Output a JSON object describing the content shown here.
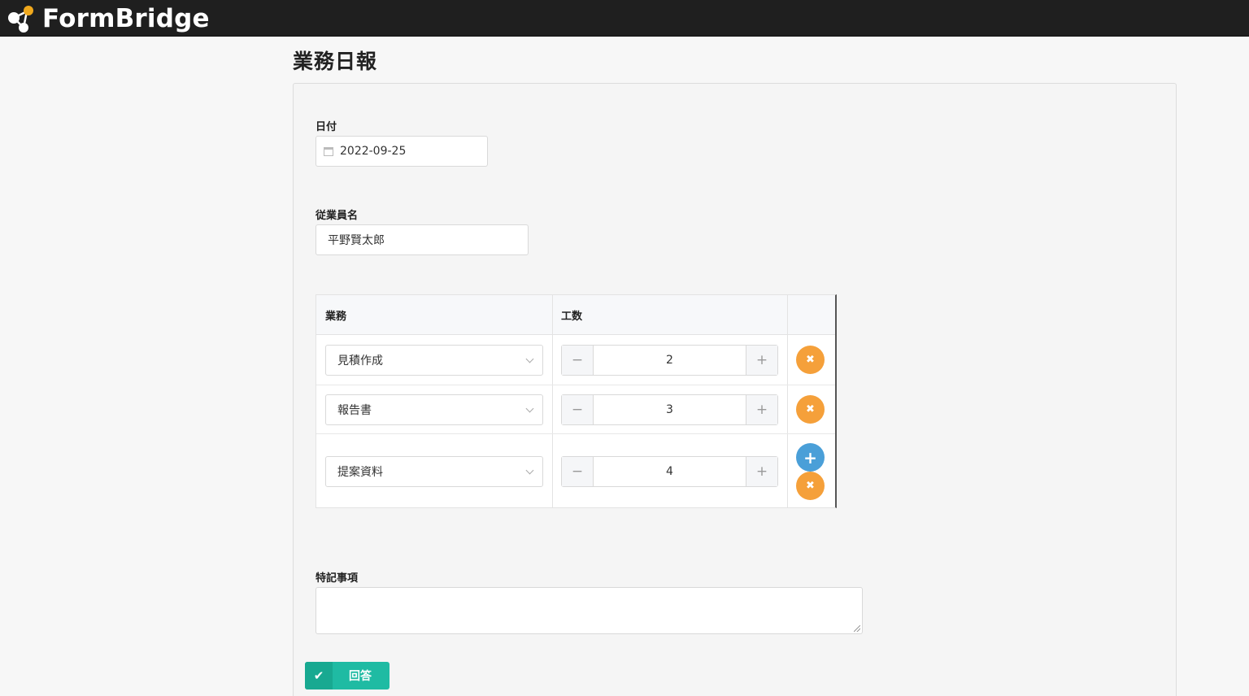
{
  "app": {
    "name": "FormBridge"
  },
  "form": {
    "title": "業務日報",
    "date_field": {
      "label": "日付",
      "value": "2022-09-25"
    },
    "employee_field": {
      "label": "従業員名",
      "value": "平野賢太郎"
    },
    "table": {
      "headers": {
        "task": "業務",
        "hours": "工数"
      },
      "rows": [
        {
          "task": "見積作成",
          "hours": "2"
        },
        {
          "task": "報告書",
          "hours": "3"
        },
        {
          "task": "提案資料",
          "hours": "4"
        }
      ],
      "minus_symbol": "−",
      "plus_symbol": "+",
      "delete_symbol": "✖",
      "add_symbol": "+"
    },
    "notes_field": {
      "label": "特記事項",
      "value": ""
    },
    "submit": {
      "label": "回答",
      "icon": "✔"
    }
  },
  "colors": {
    "header_bg": "#1f1f1f",
    "delete_button": "#f5a03a",
    "add_button": "#4a9fd8",
    "submit_button": "#1fbba3"
  }
}
